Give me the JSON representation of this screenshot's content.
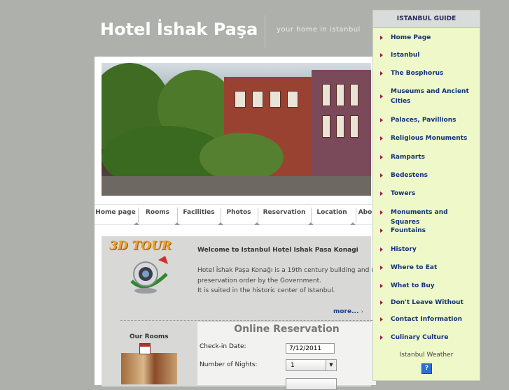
{
  "header": {
    "title": "Hotel İshak Paşa",
    "tagline": "your home in istanbul"
  },
  "nav": {
    "items": [
      "Home page",
      "Rooms",
      "Facilities",
      "Photos",
      "Reservation",
      "Location",
      "Abo"
    ]
  },
  "tour": {
    "label": "3D TOUR"
  },
  "welcome": {
    "title": "Welcome to Istanbul Hotel Ishak Pasa Konagi",
    "line1": "Hotel İshak Paşa Konağı is a 19th century building and un",
    "line2": "preservation order by the Government.",
    "line3": "It is suited in the historic center of Istanbul.",
    "more": "more..."
  },
  "rooms": {
    "title": "Our Rooms"
  },
  "reservation": {
    "title": "Online Reservation",
    "checkin_label": "Check-in Date:",
    "checkin_value": "7/12/2011",
    "nights_label": "Number of Nights:",
    "nights_value": "1"
  },
  "sidebar": {
    "title": "ISTANBUL GUIDE",
    "items": [
      "Home Page",
      "Istanbul",
      "The Bosphorus",
      "Museums and Ancient Cities",
      "Palaces, Pavillions",
      "Religious Monuments",
      "Ramparts",
      "Bedestens",
      "Towers",
      "Monuments and Squares",
      "Fountains",
      "History",
      "Where to Eat",
      "What to Buy",
      "Don't Leave Without",
      "Contact Information",
      "Culinary Culture"
    ],
    "weather_label": "Istanbul Weather"
  },
  "colors": {
    "background": "#aeb0ac",
    "sidebar_bg": "#eef8c8",
    "link_blue": "#12337a",
    "arrow_magenta": "#a2174a"
  },
  "icons": [
    "calendar-icon",
    "chevron-down-icon",
    "help-icon",
    "arrow-right-icon",
    "webcam-icon"
  ]
}
